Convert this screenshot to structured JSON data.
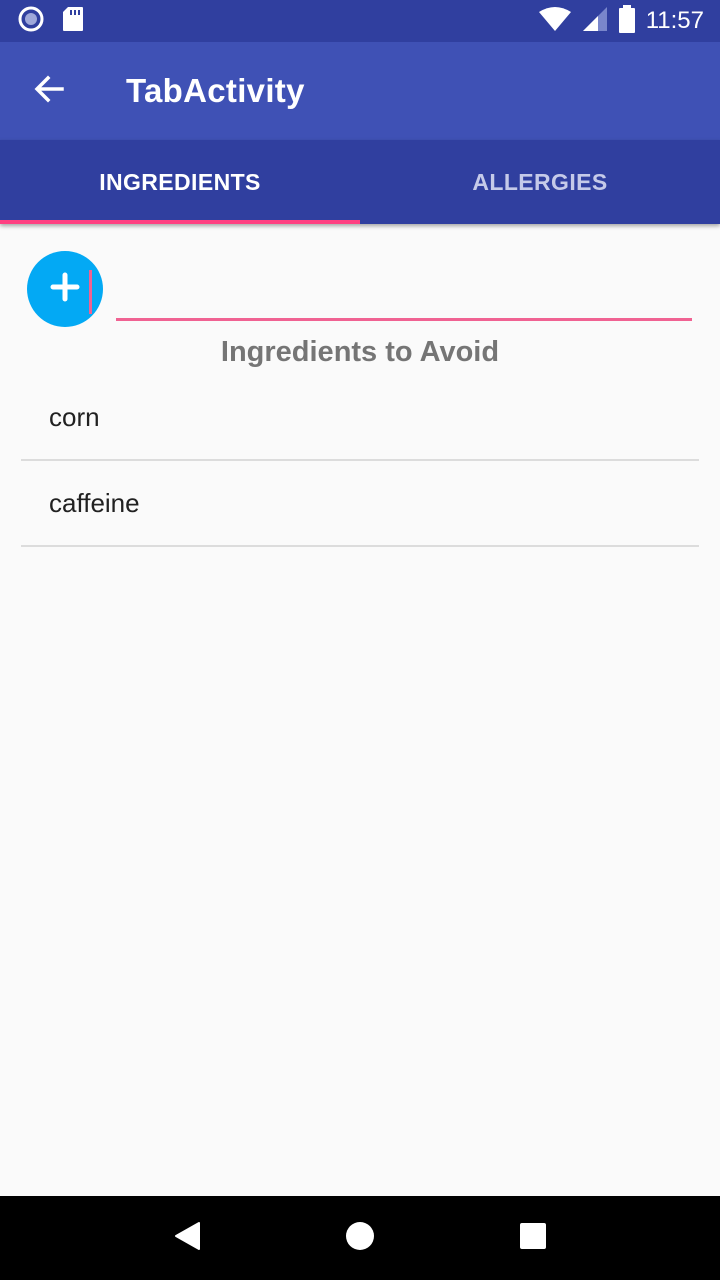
{
  "status_bar": {
    "time": "11:57",
    "icons": [
      "sync-circle-icon",
      "sd-card-icon",
      "wifi-icon",
      "signal-icon",
      "battery-icon"
    ]
  },
  "app_bar": {
    "title": "TabActivity",
    "back_icon": "arrow-back-icon",
    "background": "#3f51b5"
  },
  "tabs": [
    {
      "label": "INGREDIENTS",
      "selected": true
    },
    {
      "label": "ALLERGIES",
      "selected": false
    }
  ],
  "add_ingredient": {
    "fab_icon": "plus-icon",
    "fab_color": "#03a9f4",
    "input_value": "",
    "input_placeholder": ""
  },
  "list": {
    "heading": "Ingredients to Avoid",
    "items": [
      {
        "label": "corn"
      },
      {
        "label": "caffeine"
      }
    ]
  },
  "colors": {
    "primary": "#3f51b5",
    "primary_dark": "#303f9f",
    "accent": "#ff4081"
  },
  "nav_bar": {
    "buttons": [
      "back-triangle-icon",
      "home-circle-icon",
      "recents-square-icon"
    ]
  }
}
